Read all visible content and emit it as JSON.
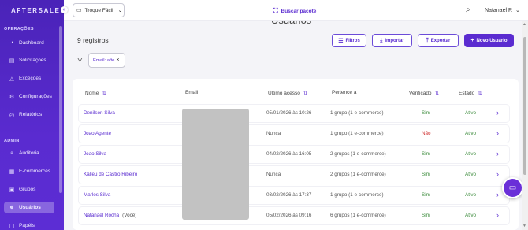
{
  "sidebar": {
    "brand": "AFTERSALE",
    "collapse_icon": "«",
    "sections": [
      {
        "label": "OPERAÇÕES"
      },
      {
        "label": "ADMIN"
      }
    ],
    "items": [
      {
        "label": "Dashboard",
        "icon": "gauge-icon",
        "glyph": "◔"
      },
      {
        "label": "Solicitações",
        "icon": "list-icon",
        "glyph": "▤"
      },
      {
        "label": "Exceções",
        "icon": "warning-icon",
        "glyph": "△"
      },
      {
        "label": "Configurações",
        "icon": "gear-icon",
        "glyph": "⚙"
      },
      {
        "label": "Relatórios",
        "icon": "report-icon",
        "glyph": "◴"
      },
      {
        "label": "Auditoria",
        "icon": "audit-icon",
        "glyph": "⌕"
      },
      {
        "label": "E-commerces",
        "icon": "store-icon",
        "glyph": "▦"
      },
      {
        "label": "Grupos",
        "icon": "groups-icon",
        "glyph": "▣"
      },
      {
        "label": "Usuários",
        "icon": "users-icon",
        "glyph": "☻",
        "active": true
      },
      {
        "label": "Papéis",
        "icon": "roles-icon",
        "glyph": "▢"
      }
    ]
  },
  "topbar": {
    "store_select": "Troque Fácil",
    "store_icon": "store-icon",
    "search_link": "Buscar pacote",
    "search_link_icon": "scan-icon",
    "user_name": "Natanael R"
  },
  "main": {
    "title": "Usuários",
    "records": "9 registros",
    "buttons": {
      "filters": "Filtros",
      "import": "Importar",
      "export": "Exportar",
      "new_user": "Novo Usuário"
    },
    "filter_chip": "Email: afte"
  },
  "table": {
    "headers": {
      "name": "Nome",
      "email": "Email",
      "last_access": "Último acesso",
      "belongs_to": "Pertence a",
      "verified": "Verificado",
      "status": "Estado"
    },
    "rows": [
      {
        "name": "Denilson Silva",
        "you": "",
        "last_access": "05/01/2026 às 10:26",
        "belongs_to": "1 grupo (1 e-commerce)",
        "verified": "Sim",
        "status": "Ativo"
      },
      {
        "name": "Joao Agente",
        "you": "",
        "last_access": "Nunca",
        "belongs_to": "1 grupo (1 e-commerce)",
        "verified": "Não",
        "status": "Ativo"
      },
      {
        "name": "Joao Silva",
        "you": "",
        "last_access": "04/02/2026 às 16:05",
        "belongs_to": "2 grupos (1 e-commerce)",
        "verified": "Sim",
        "status": "Ativo"
      },
      {
        "name": "Kalleu de Castro Ribeiro",
        "you": "",
        "last_access": "Nunca",
        "belongs_to": "2 grupos (1 e-commerce)",
        "verified": "Sim",
        "status": "Ativo"
      },
      {
        "name": "Marlos Silva",
        "you": "",
        "last_access": "03/02/2026 às 17:37",
        "belongs_to": "1 grupo (1 e-commerce)",
        "verified": "Sim",
        "status": "Ativo"
      },
      {
        "name": "Natanael Rocha",
        "you": "(Você)",
        "last_access": "05/02/2026 às 09:16",
        "belongs_to": "6 grupos (1 e-commerce)",
        "verified": "Sim",
        "status": "Ativo"
      }
    ]
  },
  "colors": {
    "brand": "#5a2bd0",
    "success": "#3a8a3a",
    "danger": "#d23b3b"
  }
}
